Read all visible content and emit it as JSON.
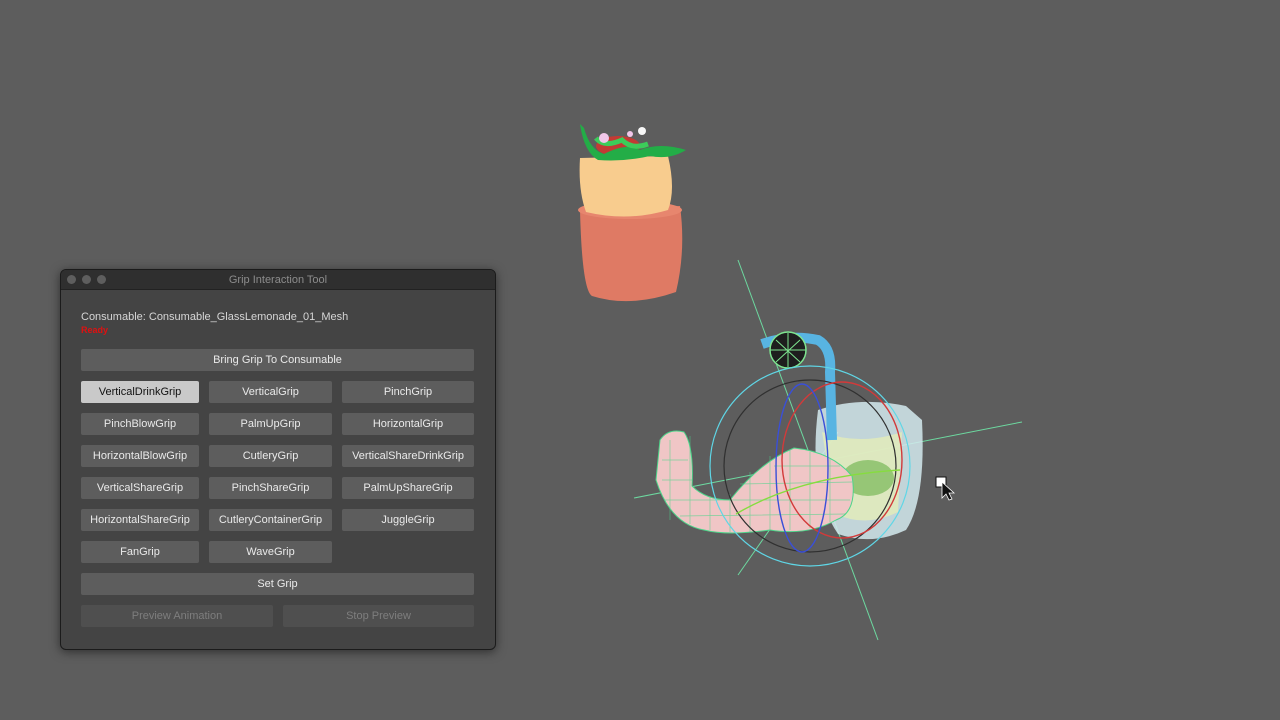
{
  "window": {
    "title": "Grip Interaction Tool",
    "consumable_label": "Consumable: Consumable_GlassLemonade_01_Mesh",
    "status_text": "Ready",
    "bring_grip_label": "Bring Grip To Consumable",
    "grips": [
      [
        "VerticalDrinkGrip",
        "VerticalGrip",
        "PinchGrip"
      ],
      [
        "PinchBlowGrip",
        "PalmUpGrip",
        "HorizontalGrip"
      ],
      [
        "HorizontalBlowGrip",
        "CutleryGrip",
        "VerticalShareDrinkGrip"
      ],
      [
        "VerticalShareGrip",
        "PinchShareGrip",
        "PalmUpShareGrip"
      ],
      [
        "HorizontalShareGrip",
        "CutleryContainerGrip",
        "JuggleGrip"
      ],
      [
        "FanGrip",
        "WaveGrip"
      ]
    ],
    "selected_grip": "VerticalDrinkGrip",
    "set_grip_label": "Set Grip",
    "preview_label": "Preview Animation",
    "stop_label": "Stop Preview"
  },
  "colors": {
    "viewport_bg": "#5d5d5d",
    "panel_bg": "#444444",
    "button_bg": "#5d5d5d",
    "button_active_bg": "#c9c9c9",
    "status_red": "#e01010",
    "gizmo_cyan": "#5fd6e6",
    "gizmo_green": "#6dd9a0"
  }
}
